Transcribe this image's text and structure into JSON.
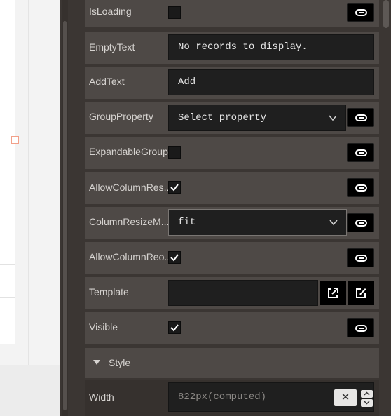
{
  "properties": {
    "isloading": {
      "label": "IsLoading",
      "checked": false
    },
    "emptytext": {
      "label": "EmptyText",
      "value": "No records to display."
    },
    "addtext": {
      "label": "AddText",
      "value": "Add"
    },
    "groupproperty": {
      "label": "GroupProperty",
      "value": "Select property"
    },
    "expandablegroups": {
      "label": "ExpandableGroups",
      "checked": false
    },
    "allowcolumnresize": {
      "label": "AllowColumnRes...",
      "checked": true
    },
    "columnresizemode": {
      "label": "ColumnResizeM...",
      "value": "fit"
    },
    "allowcolumnreorder": {
      "label": "AllowColumnReo...",
      "checked": true
    },
    "template": {
      "label": "Template",
      "value": ""
    },
    "visible": {
      "label": "Visible",
      "checked": true
    }
  },
  "style_section": {
    "title": "Style",
    "expanded": true
  },
  "width": {
    "label": "Width",
    "placeholder": "822px(computed)",
    "clear_glyph": "✕"
  },
  "icons": {
    "link": "link-icon",
    "check": "checkmark-icon",
    "chevron": "chevron-down-icon",
    "open": "open-external-icon",
    "edit": "edit-icon",
    "caret": "caret-down-icon"
  },
  "colors": {
    "panel_bg": "#3b3633",
    "row_bg": "#4e4946",
    "input_bg": "#1f1f1f",
    "button_bg": "#000000",
    "label_text": "#d6d3d0",
    "canvas_accent": "#f2a089"
  }
}
